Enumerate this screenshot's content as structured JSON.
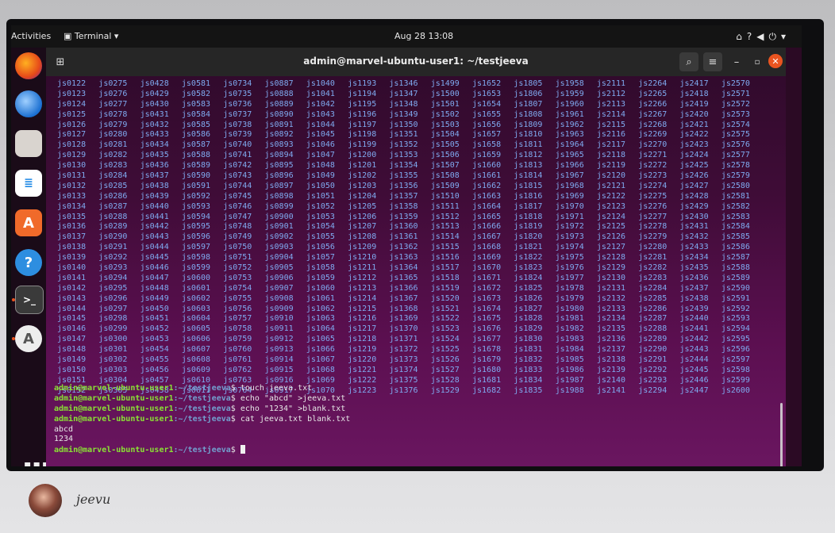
{
  "topbar": {
    "activities": "Activities",
    "app_menu": "Terminal",
    "clock": "Aug 28  13:08"
  },
  "window": {
    "title": "admin@marvel-ubuntu-user1: ~/testjeeva"
  },
  "file_grid": {
    "rows": [
      [
        "js0122",
        "js0275",
        "js0428",
        "js0581",
        "js0734",
        "js0887",
        "js1040",
        "js1193",
        "js1346",
        "js1499",
        "js1652",
        "js1805",
        "js1958",
        "js2111",
        "js2264",
        "js2417",
        "js2570"
      ],
      [
        "js0123",
        "js0276",
        "js0429",
        "js0582",
        "js0735",
        "js0888",
        "js1041",
        "js1194",
        "js1347",
        "js1500",
        "js1653",
        "js1806",
        "js1959",
        "js2112",
        "js2265",
        "js2418",
        "js2571"
      ],
      [
        "js0124",
        "js0277",
        "js0430",
        "js0583",
        "js0736",
        "js0889",
        "js1042",
        "js1195",
        "js1348",
        "js1501",
        "js1654",
        "js1807",
        "js1960",
        "js2113",
        "js2266",
        "js2419",
        "js2572"
      ],
      [
        "js0125",
        "js0278",
        "js0431",
        "js0584",
        "js0737",
        "js0890",
        "js1043",
        "js1196",
        "js1349",
        "js1502",
        "js1655",
        "js1808",
        "js1961",
        "js2114",
        "js2267",
        "js2420",
        "js2573"
      ],
      [
        "js0126",
        "js0279",
        "js0432",
        "js0585",
        "js0738",
        "js0891",
        "js1044",
        "js1197",
        "js1350",
        "js1503",
        "js1656",
        "js1809",
        "js1962",
        "js2115",
        "js2268",
        "js2421",
        "js2574"
      ],
      [
        "js0127",
        "js0280",
        "js0433",
        "js0586",
        "js0739",
        "js0892",
        "js1045",
        "js1198",
        "js1351",
        "js1504",
        "js1657",
        "js1810",
        "js1963",
        "js2116",
        "js2269",
        "js2422",
        "js2575"
      ],
      [
        "js0128",
        "js0281",
        "js0434",
        "js0587",
        "js0740",
        "js0893",
        "js1046",
        "js1199",
        "js1352",
        "js1505",
        "js1658",
        "js1811",
        "js1964",
        "js2117",
        "js2270",
        "js2423",
        "js2576"
      ],
      [
        "js0129",
        "js0282",
        "js0435",
        "js0588",
        "js0741",
        "js0894",
        "js1047",
        "js1200",
        "js1353",
        "js1506",
        "js1659",
        "js1812",
        "js1965",
        "js2118",
        "js2271",
        "js2424",
        "js2577"
      ],
      [
        "js0130",
        "js0283",
        "js0436",
        "js0589",
        "js0742",
        "js0895",
        "js1048",
        "js1201",
        "js1354",
        "js1507",
        "js1660",
        "js1813",
        "js1966",
        "js2119",
        "js2272",
        "js2425",
        "js2578"
      ],
      [
        "js0131",
        "js0284",
        "js0437",
        "js0590",
        "js0743",
        "js0896",
        "js1049",
        "js1202",
        "js1355",
        "js1508",
        "js1661",
        "js1814",
        "js1967",
        "js2120",
        "js2273",
        "js2426",
        "js2579"
      ],
      [
        "js0132",
        "js0285",
        "js0438",
        "js0591",
        "js0744",
        "js0897",
        "js1050",
        "js1203",
        "js1356",
        "js1509",
        "js1662",
        "js1815",
        "js1968",
        "js2121",
        "js2274",
        "js2427",
        "js2580"
      ],
      [
        "js0133",
        "js0286",
        "js0439",
        "js0592",
        "js0745",
        "js0898",
        "js1051",
        "js1204",
        "js1357",
        "js1510",
        "js1663",
        "js1816",
        "js1969",
        "js2122",
        "js2275",
        "js2428",
        "js2581"
      ],
      [
        "js0134",
        "js0287",
        "js0440",
        "js0593",
        "js0746",
        "js0899",
        "js1052",
        "js1205",
        "js1358",
        "js1511",
        "js1664",
        "js1817",
        "js1970",
        "js2123",
        "js2276",
        "js2429",
        "js2582"
      ],
      [
        "js0135",
        "js0288",
        "js0441",
        "js0594",
        "js0747",
        "js0900",
        "js1053",
        "js1206",
        "js1359",
        "js1512",
        "js1665",
        "js1818",
        "js1971",
        "js2124",
        "js2277",
        "js2430",
        "js2583"
      ],
      [
        "js0136",
        "js0289",
        "js0442",
        "js0595",
        "js0748",
        "js0901",
        "js1054",
        "js1207",
        "js1360",
        "js1513",
        "js1666",
        "js1819",
        "js1972",
        "js2125",
        "js2278",
        "js2431",
        "js2584"
      ],
      [
        "js0137",
        "js0290",
        "js0443",
        "js0596",
        "js0749",
        "js0902",
        "js1055",
        "js1208",
        "js1361",
        "js1514",
        "js1667",
        "js1820",
        "js1973",
        "js2126",
        "js2279",
        "js2432",
        "js2585"
      ],
      [
        "js0138",
        "js0291",
        "js0444",
        "js0597",
        "js0750",
        "js0903",
        "js1056",
        "js1209",
        "js1362",
        "js1515",
        "js1668",
        "js1821",
        "js1974",
        "js2127",
        "js2280",
        "js2433",
        "js2586"
      ],
      [
        "js0139",
        "js0292",
        "js0445",
        "js0598",
        "js0751",
        "js0904",
        "js1057",
        "js1210",
        "js1363",
        "js1516",
        "js1669",
        "js1822",
        "js1975",
        "js2128",
        "js2281",
        "js2434",
        "js2587"
      ],
      [
        "js0140",
        "js0293",
        "js0446",
        "js0599",
        "js0752",
        "js0905",
        "js1058",
        "js1211",
        "js1364",
        "js1517",
        "js1670",
        "js1823",
        "js1976",
        "js2129",
        "js2282",
        "js2435",
        "js2588"
      ],
      [
        "js0141",
        "js0294",
        "js0447",
        "js0600",
        "js0753",
        "js0906",
        "js1059",
        "js1212",
        "js1365",
        "js1518",
        "js1671",
        "js1824",
        "js1977",
        "js2130",
        "js2283",
        "js2436",
        "js2589"
      ],
      [
        "js0142",
        "js0295",
        "js0448",
        "js0601",
        "js0754",
        "js0907",
        "js1060",
        "js1213",
        "js1366",
        "js1519",
        "js1672",
        "js1825",
        "js1978",
        "js2131",
        "js2284",
        "js2437",
        "js2590"
      ],
      [
        "js0143",
        "js0296",
        "js0449",
        "js0602",
        "js0755",
        "js0908",
        "js1061",
        "js1214",
        "js1367",
        "js1520",
        "js1673",
        "js1826",
        "js1979",
        "js2132",
        "js2285",
        "js2438",
        "js2591"
      ],
      [
        "js0144",
        "js0297",
        "js0450",
        "js0603",
        "js0756",
        "js0909",
        "js1062",
        "js1215",
        "js1368",
        "js1521",
        "js1674",
        "js1827",
        "js1980",
        "js2133",
        "js2286",
        "js2439",
        "js2592"
      ],
      [
        "js0145",
        "js0298",
        "js0451",
        "js0604",
        "js0757",
        "js0910",
        "js1063",
        "js1216",
        "js1369",
        "js1522",
        "js1675",
        "js1828",
        "js1981",
        "js2134",
        "js2287",
        "js2440",
        "js2593"
      ],
      [
        "js0146",
        "js0299",
        "js0452",
        "js0605",
        "js0758",
        "js0911",
        "js1064",
        "js1217",
        "js1370",
        "js1523",
        "js1676",
        "js1829",
        "js1982",
        "js2135",
        "js2288",
        "js2441",
        "js2594"
      ],
      [
        "js0147",
        "js0300",
        "js0453",
        "js0606",
        "js0759",
        "js0912",
        "js1065",
        "js1218",
        "js1371",
        "js1524",
        "js1677",
        "js1830",
        "js1983",
        "js2136",
        "js2289",
        "js2442",
        "js2595"
      ],
      [
        "js0148",
        "js0301",
        "js0454",
        "js0607",
        "js0760",
        "js0913",
        "js1066",
        "js1219",
        "js1372",
        "js1525",
        "js1678",
        "js1831",
        "js1984",
        "js2137",
        "js2290",
        "js2443",
        "js2596"
      ],
      [
        "js0149",
        "js0302",
        "js0455",
        "js0608",
        "js0761",
        "js0914",
        "js1067",
        "js1220",
        "js1373",
        "js1526",
        "js1679",
        "js1832",
        "js1985",
        "js2138",
        "js2291",
        "js2444",
        "js2597"
      ],
      [
        "js0150",
        "js0303",
        "js0456",
        "js0609",
        "js0762",
        "js0915",
        "js1068",
        "js1221",
        "js1374",
        "js1527",
        "js1680",
        "js1833",
        "js1986",
        "js2139",
        "js2292",
        "js2445",
        "js2598"
      ],
      [
        "js0151",
        "js0304",
        "js0457",
        "js0610",
        "js0763",
        "js0916",
        "js1069",
        "js1222",
        "js1375",
        "js1528",
        "js1681",
        "js1834",
        "js1987",
        "js2140",
        "js2293",
        "js2446",
        "js2599"
      ],
      [
        "js0152",
        "js0305",
        "js0458",
        "js0611",
        "js0764",
        "js0917",
        "js1070",
        "js1223",
        "js1376",
        "js1529",
        "js1682",
        "js1835",
        "js1988",
        "js2141",
        "js2294",
        "js2447",
        "js2600"
      ]
    ]
  },
  "session": {
    "prompt_user": "admin@marvel-ubuntu-user1",
    "prompt_path": ":~/testjeeva",
    "prompt_symbol": "$",
    "commands": [
      "touch jeeva.txt",
      "echo \"abcd\" >jeeva.txt",
      "echo \"1234\" >blank.txt",
      "cat jeeva.txt blank.txt"
    ],
    "output": [
      "abcd",
      "1234"
    ]
  },
  "footer": {
    "signature": "jeevu"
  },
  "colors": {
    "terminal_bg": "#5b0f50",
    "file_text": "#7faaf0",
    "prompt_user": "#8ae234",
    "prompt_path": "#729fcf",
    "close_button": "#e95420"
  },
  "dock_icons": [
    "firefox-icon",
    "thunderbird-icon",
    "files-icon",
    "writer-icon",
    "software-icon",
    "help-icon",
    "terminal-icon",
    "updater-icon"
  ],
  "tray_icons": [
    "network-icon",
    "help-icon",
    "volume-icon",
    "power-icon"
  ]
}
